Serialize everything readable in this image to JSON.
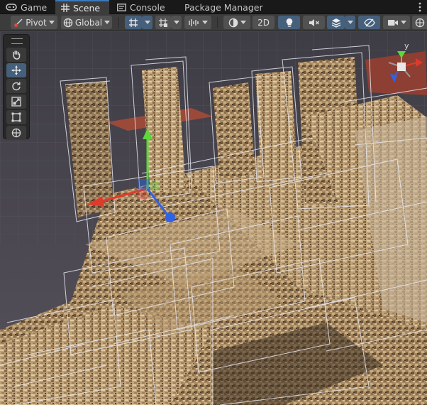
{
  "tabs": [
    {
      "label": "Game",
      "icon": "gamepad-icon",
      "active": false
    },
    {
      "label": "Scene",
      "icon": "scene-grid-icon",
      "active": true
    },
    {
      "label": "Console",
      "icon": "console-icon",
      "active": false
    },
    {
      "label": "Package Manager",
      "icon": "package-icon",
      "active": false
    }
  ],
  "toolbar": {
    "pivot_label": "Pivot",
    "global_label": "Global",
    "mode_2d_label": "2D"
  },
  "gizmo": {
    "up_axis_label": "y"
  },
  "tools": [
    {
      "name": "hand-tool",
      "icon": "hand-icon",
      "active": false
    },
    {
      "name": "move-tool",
      "icon": "move-arrows-icon",
      "active": true
    },
    {
      "name": "rotate-tool",
      "icon": "rotate-icon",
      "active": false
    },
    {
      "name": "scale-tool",
      "icon": "scale-icon",
      "active": false
    },
    {
      "name": "rect-tool",
      "icon": "rect-transform-icon",
      "active": false
    },
    {
      "name": "transform-tool",
      "icon": "transform-icon",
      "active": false
    }
  ],
  "colors": {
    "active_blue": "#46607c",
    "x_axis": "#e03a2a",
    "y_axis": "#5fd63b",
    "z_axis": "#2f63e6",
    "terrain": "#a88a63"
  }
}
